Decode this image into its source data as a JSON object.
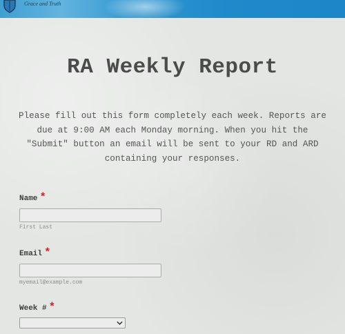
{
  "header": {
    "tagline": "Grace and Truth",
    "logo_icon": "shield-icon"
  },
  "form": {
    "title": "RA Weekly Report",
    "intro": "Please fill out this form completely each week. Reports are due at 9:00 AM each Monday morning. When you hit the \"Submit\" button an email will be sent to your RD and ARD containing your responses.",
    "required_marker": "*",
    "fields": {
      "name": {
        "label": "Name",
        "value": "",
        "sublabel": "First Last"
      },
      "email": {
        "label": "Email",
        "value": "",
        "sublabel": "myemail@example.com"
      },
      "week": {
        "label": "Week #",
        "selected": "",
        "icon": "chevron-down-icon"
      }
    }
  },
  "colors": {
    "header_blue": "#1f8acb",
    "required_red": "#d0202a",
    "background": "#e4e6e4"
  }
}
